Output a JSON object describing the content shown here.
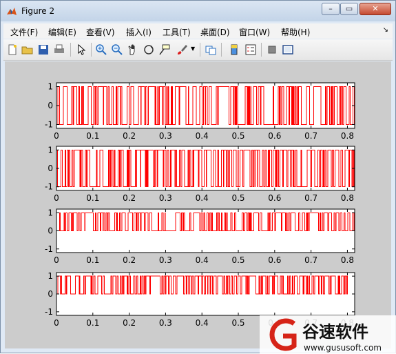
{
  "window": {
    "title": "Figure 2"
  },
  "menu": [
    "文件(F)",
    "编辑(E)",
    "查看(V)",
    "插入(I)",
    "工具(T)",
    "桌面(D)",
    "窗口(W)",
    "帮助(H)"
  ],
  "toolbar_icons": [
    "new-figure-icon",
    "open-file-icon",
    "save-icon",
    "print-icon",
    "arrow-icon",
    "zoom-in-icon",
    "zoom-out-icon",
    "pan-icon",
    "rotate-3d-icon",
    "data-cursor-icon",
    "brush-icon",
    "brush-dropdown-icon",
    "link-plot-icon",
    "colorbar-icon",
    "legend-icon",
    "hide-plot-tools-icon",
    "show-plot-tools-icon"
  ],
  "watermark": {
    "brand": "谷速软件",
    "url": "www.gususoft.com"
  },
  "chart_data": [
    {
      "type": "line",
      "color": "#ff0000",
      "xlim": [
        0,
        0.82
      ],
      "ylim": [
        -1.2,
        1.2
      ],
      "xticks": [
        "0",
        "0.1",
        "0.2",
        "0.3",
        "0.4",
        "0.5",
        "0.6",
        "0.7",
        "0.8"
      ],
      "yticks": [
        "-1",
        "0",
        "1"
      ],
      "series": [
        {
          "signal": "bipolar random binary sequence (±1)"
        }
      ]
    },
    {
      "type": "line",
      "color": "#ff0000",
      "xlim": [
        0,
        0.82
      ],
      "ylim": [
        -1.2,
        1.2
      ],
      "xticks": [
        "0",
        "0.1",
        "0.2",
        "0.3",
        "0.4",
        "0.5",
        "0.6",
        "0.7",
        "0.8"
      ],
      "yticks": [
        "-1",
        "0",
        "1"
      ],
      "series": [
        {
          "signal": "bipolar random binary sequence (±1)"
        }
      ]
    },
    {
      "type": "line",
      "color": "#ff0000",
      "xlim": [
        0,
        0.82
      ],
      "ylim": [
        -1.2,
        1.2
      ],
      "xticks": [
        "0",
        "0.1",
        "0.2",
        "0.3",
        "0.4",
        "0.5",
        "0.6",
        "0.7",
        "0.8"
      ],
      "yticks": [
        "-1",
        "0",
        "1"
      ],
      "series": [
        {
          "signal": "unipolar random binary sequence (0/1)"
        }
      ]
    },
    {
      "type": "line",
      "color": "#ff0000",
      "xlim": [
        0,
        0.82
      ],
      "ylim": [
        -1.2,
        1.2
      ],
      "xticks": [
        "0",
        "0.1",
        "0.2",
        "0.3",
        "0.4",
        "0.5",
        "0.6",
        "0.7",
        "0.8"
      ],
      "yticks": [
        "-1",
        "0",
        "1"
      ],
      "series": [
        {
          "signal": "unipolar random binary sequence (0/1)"
        }
      ]
    }
  ]
}
